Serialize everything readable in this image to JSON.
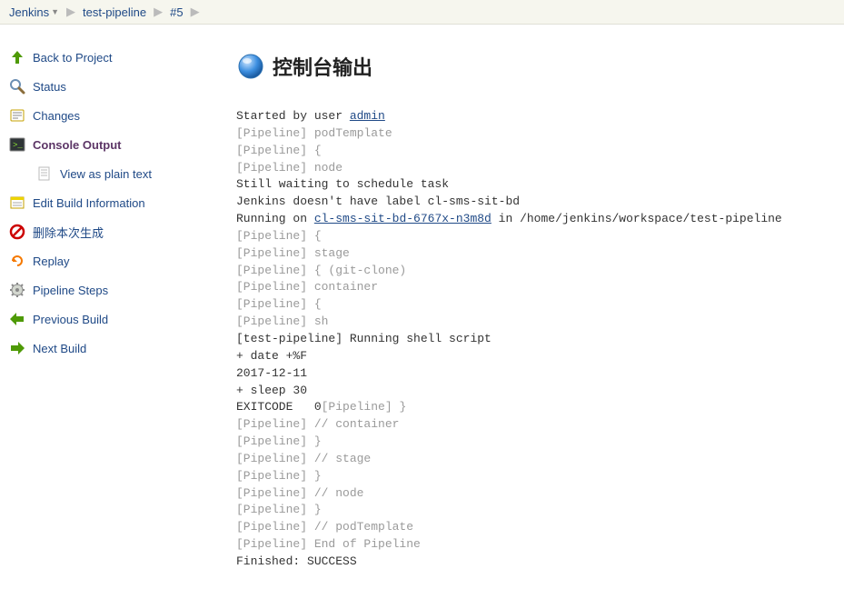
{
  "breadcrumb": {
    "root": "Jenkins",
    "job": "test-pipeline",
    "build": "#5"
  },
  "sidebar": {
    "back": "Back to Project",
    "status": "Status",
    "changes": "Changes",
    "console": "Console Output",
    "plain": "View as plain text",
    "edit": "Edit Build Information",
    "delete": "删除本次生成",
    "replay": "Replay",
    "steps": "Pipeline Steps",
    "prev": "Previous Build",
    "next": "Next Build"
  },
  "page": {
    "title": "控制台输出"
  },
  "console": {
    "started_prefix": "Started by user ",
    "user_link": "admin",
    "l01": "[Pipeline] podTemplate",
    "l02": "[Pipeline] {",
    "l03": "[Pipeline] node",
    "wait": "Still waiting to schedule task",
    "nolabel": "Jenkins doesn't have label cl-sms-sit-bd",
    "run_prefix": "Running on ",
    "node_link": "cl-sms-sit-bd-6767x-n3m8d",
    "run_suffix": " in /home/jenkins/workspace/test-pipeline",
    "l06": "[Pipeline] {",
    "l07": "[Pipeline] stage",
    "l08": "[Pipeline] { (git-clone)",
    "l09": "[Pipeline] container",
    "l10": "[Pipeline] {",
    "l11": "[Pipeline] sh",
    "script_head": "[test-pipeline] Running shell script",
    "cmd1": "+ date +%F",
    "date_out": "2017-12-11",
    "cmd2": "+ sleep 30",
    "exit_prefix": "EXITCODE   0",
    "l12a": "[Pipeline] }",
    "l12": "[Pipeline] // container",
    "l13": "[Pipeline] }",
    "l14": "[Pipeline] // stage",
    "l15": "[Pipeline] }",
    "l16": "[Pipeline] // node",
    "l17": "[Pipeline] }",
    "l18": "[Pipeline] // podTemplate",
    "l19": "[Pipeline] End of Pipeline",
    "finished": "Finished: SUCCESS"
  }
}
